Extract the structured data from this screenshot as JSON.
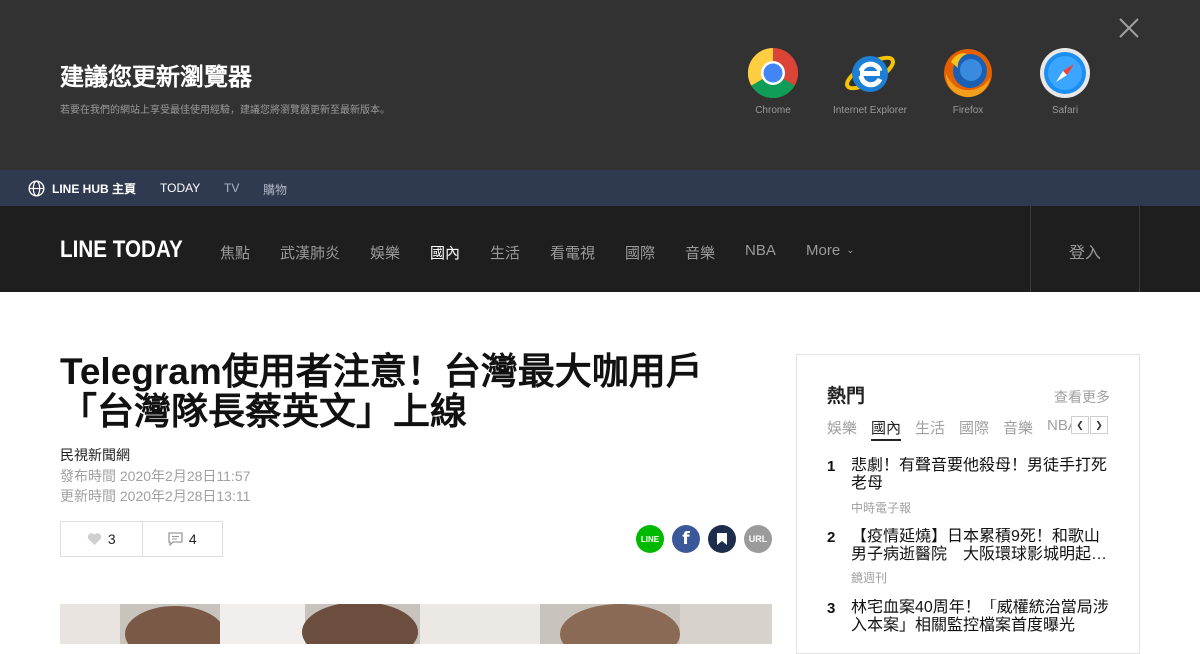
{
  "banner": {
    "title": "建議您更新瀏覽器",
    "subtitle": "若要在我們的網站上享受最佳使用經驗，建議您將瀏覽器更新至最新版本。",
    "browsers": [
      {
        "name": "Chrome",
        "icon": "chrome-icon"
      },
      {
        "name": "Internet Explorer",
        "icon": "internet-explorer-icon"
      },
      {
        "name": "Firefox",
        "icon": "firefox-icon"
      },
      {
        "name": "Safari",
        "icon": "safari-icon"
      }
    ]
  },
  "hubbar": {
    "home_label": "LINE HUB 主頁",
    "links": [
      "TODAY",
      "TV",
      "購物"
    ]
  },
  "nav": {
    "logo": "LINE TODAY",
    "items": [
      "焦點",
      "武漢肺炎",
      "娛樂",
      "國內",
      "生活",
      "看電視",
      "國際",
      "音樂",
      "NBA",
      "More"
    ],
    "active": "國內",
    "login": "登入"
  },
  "article": {
    "title": "Telegram使用者注意！台灣最大咖用戶「台灣隊長蔡英文」上線",
    "source": "民視新聞網",
    "published": "發布時間 2020年2月28日11:57",
    "updated": "更新時間 2020年2月28日13:11",
    "likes": "3",
    "comments": "4",
    "share": {
      "line": "LINE",
      "facebook": "f",
      "url": "URL"
    }
  },
  "sidebar": {
    "title": "熱門",
    "more": "查看更多",
    "tabs": [
      "娛樂",
      "國內",
      "生活",
      "國際",
      "音樂",
      "NBA"
    ],
    "active_tab": "國內",
    "news": [
      {
        "rank": "1",
        "title": "悲劇！有聲音要他殺母！男徒手打死老母",
        "source": "中時電子報"
      },
      {
        "rank": "2",
        "title": "【疫情延燒】日本累積9死！和歌山男子病逝醫院　大阪環球影城明起…",
        "source": "鏡週刊"
      },
      {
        "rank": "3",
        "title": "林宅血案40周年！「威權統治當局涉入本案」相關監控檔案首度曝光",
        "source": ""
      }
    ]
  },
  "colors": {
    "banner_bg": "#323232",
    "hubbar_bg": "#2f3a50",
    "nav_bg": "#1e1e1e",
    "line_green": "#00b900",
    "facebook_blue": "#3b5998",
    "keep_navy": "#1e2d4c",
    "url_gray": "#9b9b9b"
  }
}
